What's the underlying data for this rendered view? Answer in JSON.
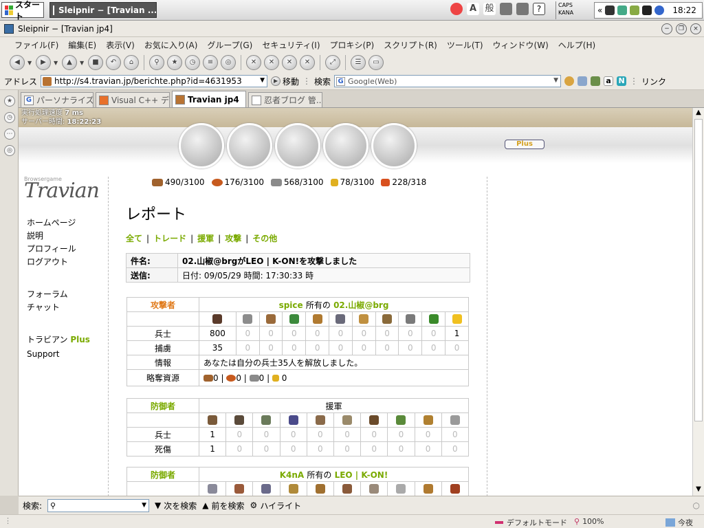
{
  "taskbar": {
    "start_label": "スタート",
    "task_label": "Sleipnir − [Travian ...",
    "caps_label": "CAPS",
    "kana_label": "KANA",
    "clock": "18:22"
  },
  "window": {
    "title": "Sleipnir − [Travian jp4]"
  },
  "menu": [
    "ファイル(F)",
    "編集(E)",
    "表示(V)",
    "お気に入り(A)",
    "グループ(G)",
    "セキュリティ(I)",
    "プロキシ(P)",
    "スクリプト(R)",
    "ツール(T)",
    "ウィンドウ(W)",
    "ヘルプ(H)"
  ],
  "address": {
    "label": "アドレス",
    "url": "http://s4.travian.jp/berichte.php?id=4631953",
    "go_label": "移動",
    "search_label": "検索",
    "search_engine": "Google(Web)",
    "links_label": "リンク"
  },
  "tabs": [
    {
      "label": "パーソナライズド..."
    },
    {
      "label": "Visual C++ デ..."
    },
    {
      "label": "Travian jp4"
    },
    {
      "label": "忍者ブログ 管..."
    }
  ],
  "page": {
    "perf_label": "実行処理速度",
    "perf_value": "7 ms",
    "server_label": "サーバー時間:",
    "server_time": "18:22:23",
    "plus_label": "Plus",
    "logo_text": "Travian",
    "logo_sub": "Browsergame",
    "left_menu": {
      "home": "ホームページ",
      "manual": "説明",
      "profile": "プロフィール",
      "logout": "ログアウト",
      "forum": "フォーラム",
      "chat": "チャット",
      "travian_plus": "トラビアン",
      "plus_word": "Plus",
      "support": "Support"
    },
    "resources": [
      {
        "name": "wood",
        "value": "490/3100"
      },
      {
        "name": "clay",
        "value": "176/3100"
      },
      {
        "name": "iron",
        "value": "568/3100"
      },
      {
        "name": "crop",
        "value": "78/3100"
      },
      {
        "name": "consumption",
        "value": "228/318"
      }
    ],
    "title": "レポート",
    "subnav": [
      "全て",
      "トレード",
      "援軍",
      "攻撃",
      "その他"
    ],
    "report": {
      "subject_label": "件名:",
      "subject": "02.山椒@brgがLEO | K-ON!を攻撃しました",
      "sent_label": "送信:",
      "sent": "日付: 09/05/29 時間: 17:30:33 時"
    },
    "attacker": {
      "role": "攻撃者",
      "player": "spice",
      "owner_word": "所有の",
      "village": "02.山椒@brg",
      "troops_label": "兵士",
      "troops": [
        "800",
        "0",
        "0",
        "0",
        "0",
        "0",
        "0",
        "0",
        "0",
        "0",
        "1"
      ],
      "captives_label": "捕虜",
      "captives": [
        "35",
        "0",
        "0",
        "0",
        "0",
        "0",
        "0",
        "0",
        "0",
        "0",
        "0"
      ],
      "info_label": "情報",
      "info": "あなたは自分の兵士35人を解放しました。",
      "loot_label": "略奪資源",
      "loot": [
        "0",
        "0",
        "0",
        "0"
      ]
    },
    "defender1": {
      "role": "防御者",
      "header": "援軍",
      "troops_label": "兵士",
      "troops": [
        "1",
        "0",
        "0",
        "0",
        "0",
        "0",
        "0",
        "0",
        "0",
        "0"
      ],
      "dead_label": "死傷",
      "dead": [
        "1",
        "0",
        "0",
        "0",
        "0",
        "0",
        "0",
        "0",
        "0",
        "0"
      ]
    },
    "defender2": {
      "role": "防御者",
      "player": "K4nA",
      "owner_word": "所有の",
      "village": "LEO | K-ON!"
    }
  },
  "findbar": {
    "label": "検索:",
    "next": "次を検索",
    "prev": "前を検索",
    "highlight": "ハイライト"
  },
  "status": {
    "mode": "デフォルトモード",
    "zoom": "100%",
    "weather": "今夜"
  },
  "colors": {
    "accent_green": "#7aaa00",
    "role_orange": "#e07a1a",
    "plus_gold": "#d4a020"
  }
}
